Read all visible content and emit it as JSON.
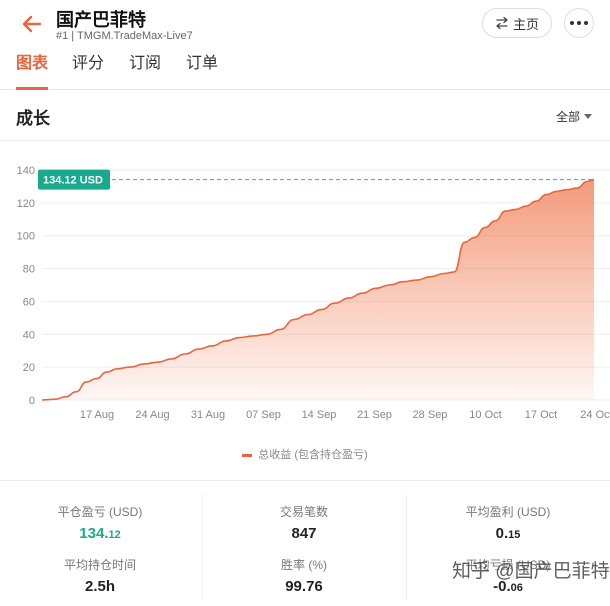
{
  "header": {
    "title": "国产巴菲特",
    "subtitle": "#1 | TMGM.TradeMax-Live7",
    "home_label": "主页"
  },
  "tabs": [
    {
      "label": "图表",
      "active": true
    },
    {
      "label": "评分",
      "active": false
    },
    {
      "label": "订阅",
      "active": false
    },
    {
      "label": "订单",
      "active": false
    }
  ],
  "section": {
    "title": "成长",
    "filter_label": "全部"
  },
  "colors": {
    "accent": "#e8663d",
    "green": "#19a98c",
    "dashed": "#2bb3a6"
  },
  "chart_data": {
    "type": "area",
    "ylim": [
      0,
      140
    ],
    "yticks": [
      "0",
      "20",
      "40",
      "60",
      "80",
      "100",
      "120",
      "140"
    ],
    "xticks": [
      "17 Aug",
      "24 Aug",
      "31 Aug",
      "07 Sep",
      "14 Sep",
      "21 Sep",
      "28 Sep",
      "10 Oct",
      "17 Oct",
      "24 Oct"
    ],
    "current_label": "134.12 USD",
    "current_value": 134.12,
    "legend": "总收益 (包含持仓盈亏)",
    "series": [
      {
        "name": "总收益 (包含持仓盈亏)",
        "points": [
          [
            0,
            0
          ],
          [
            4,
            0.5
          ],
          [
            7,
            2
          ],
          [
            10,
            5
          ],
          [
            13,
            11
          ],
          [
            16,
            13
          ],
          [
            19,
            17
          ],
          [
            22,
            19
          ],
          [
            26,
            20
          ],
          [
            30,
            22
          ],
          [
            34,
            23
          ],
          [
            38,
            25
          ],
          [
            42,
            28
          ],
          [
            46,
            31
          ],
          [
            50,
            33
          ],
          [
            54,
            36
          ],
          [
            58,
            38
          ],
          [
            62,
            39
          ],
          [
            66,
            40
          ],
          [
            70,
            43
          ],
          [
            74,
            49
          ],
          [
            78,
            52
          ],
          [
            82,
            55
          ],
          [
            86,
            59
          ],
          [
            90,
            62
          ],
          [
            94,
            65
          ],
          [
            98,
            68
          ],
          [
            102,
            70
          ],
          [
            106,
            72
          ],
          [
            110,
            73
          ],
          [
            114,
            75
          ],
          [
            118,
            77
          ],
          [
            121,
            78
          ],
          [
            124,
            96
          ],
          [
            127,
            99
          ],
          [
            130,
            105
          ],
          [
            133,
            109
          ],
          [
            136,
            115
          ],
          [
            139,
            116
          ],
          [
            142,
            118
          ],
          [
            145,
            121
          ],
          [
            148,
            125
          ],
          [
            151,
            127
          ],
          [
            154,
            128
          ],
          [
            157,
            129
          ],
          [
            160,
            133
          ],
          [
            162,
            134.12
          ]
        ]
      }
    ]
  },
  "stats": [
    {
      "label": "平仓盈亏 (USD)",
      "value": "134.",
      "value_small": "12",
      "green": true
    },
    {
      "label": "交易笔数",
      "value": "847",
      "value_small": "",
      "green": false
    },
    {
      "label": "平均盈利 (USD)",
      "value": "0.",
      "value_small": "15",
      "green": false
    },
    {
      "label": "平均持仓时间",
      "value": "2.5h",
      "value_small": "",
      "green": false
    },
    {
      "label": "胜率 (%)",
      "value": "99.76",
      "value_small": "",
      "green": false
    },
    {
      "label": "平均亏损 (USD)",
      "value": "-0.",
      "value_small": "06",
      "green": false
    }
  ],
  "watermark": "知乎 @国产巴菲特"
}
